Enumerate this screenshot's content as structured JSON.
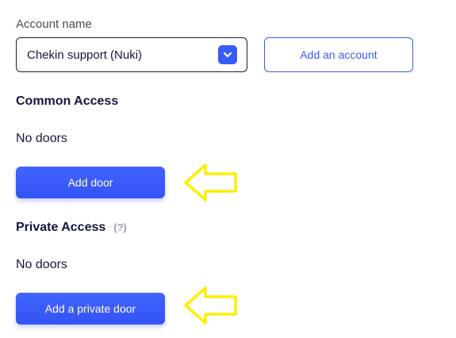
{
  "account": {
    "label": "Account name",
    "selected": "Chekin support (Nuki)",
    "add_account_label": "Add an account"
  },
  "common_access": {
    "heading": "Common Access",
    "empty_text": "No doors",
    "add_button_label": "Add door"
  },
  "private_access": {
    "heading": "Private Access",
    "help_hint": "(?)",
    "empty_text": "No doors",
    "add_button_label": "Add a private door"
  },
  "colors": {
    "accent": "#385cf8",
    "text": "#161643",
    "annotation_arrow": "#ffee00"
  },
  "icons": {
    "select_chevron": "chevron-down-icon",
    "annotation": "left-arrow-outline-icon"
  }
}
